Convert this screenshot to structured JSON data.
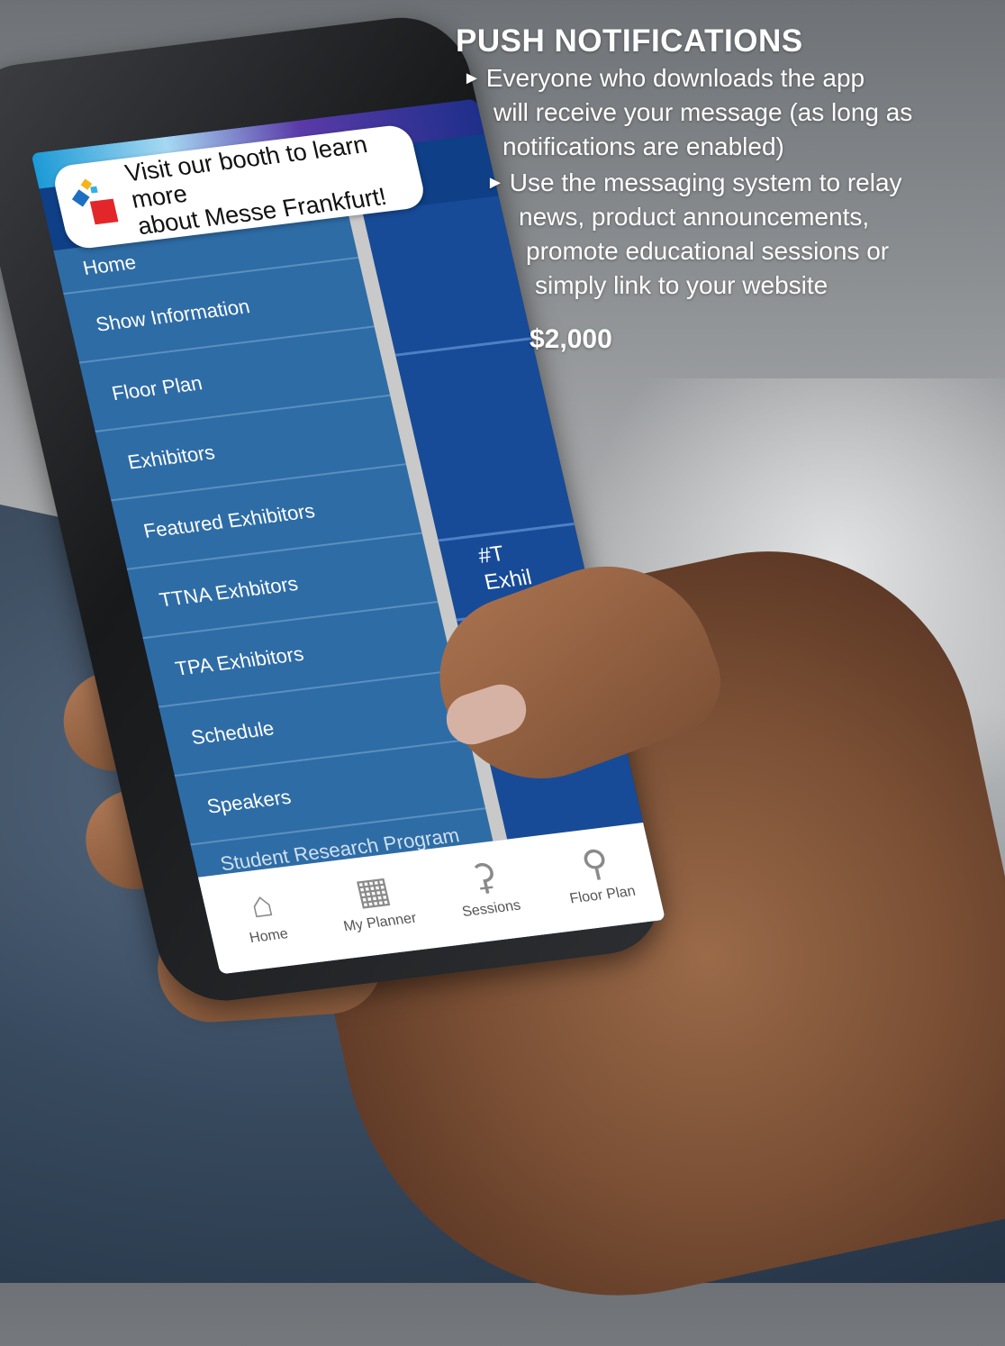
{
  "promo": {
    "message": "Visit our booth to learn more\nabout Messe Frankfurt!"
  },
  "menu": {
    "items": [
      {
        "label": "Home"
      },
      {
        "label": "Show Information"
      },
      {
        "label": "Floor Plan"
      },
      {
        "label": "Exhibitors"
      },
      {
        "label": "Featured Exhibitors"
      },
      {
        "label": "TTNA Exhbitors"
      },
      {
        "label": "TPA Exhibitors"
      },
      {
        "label": "Schedule"
      },
      {
        "label": "Speakers"
      },
      {
        "label": "Student Research Program"
      }
    ]
  },
  "content_peek": {
    "line1": "#T",
    "line2": "Exhil"
  },
  "tabbar": {
    "tabs": [
      {
        "label": "Home",
        "icon": "home-icon"
      },
      {
        "label": "My Planner",
        "icon": "calendar-icon"
      },
      {
        "label": "Sessions",
        "icon": "microphone-icon"
      },
      {
        "label": "Floor Plan",
        "icon": "map-pin-icon"
      }
    ]
  },
  "overlay": {
    "headline": "PUSH NOTIFICATIONS",
    "bullet1": {
      "line1": "Everyone who downloads the app",
      "line2": "will receive your message (as long as",
      "line3": "notifications are enabled)"
    },
    "bullet2": {
      "line1": "Use the messaging system to relay",
      "line2": "news, product announcements,",
      "line3": "promote educational sessions or",
      "line4": "simply link to your website"
    },
    "price": "$2,000"
  },
  "colors": {
    "menu_bg": "#2e6ca6",
    "content_bg": "#174b97",
    "accent_red": "#e3262a"
  }
}
